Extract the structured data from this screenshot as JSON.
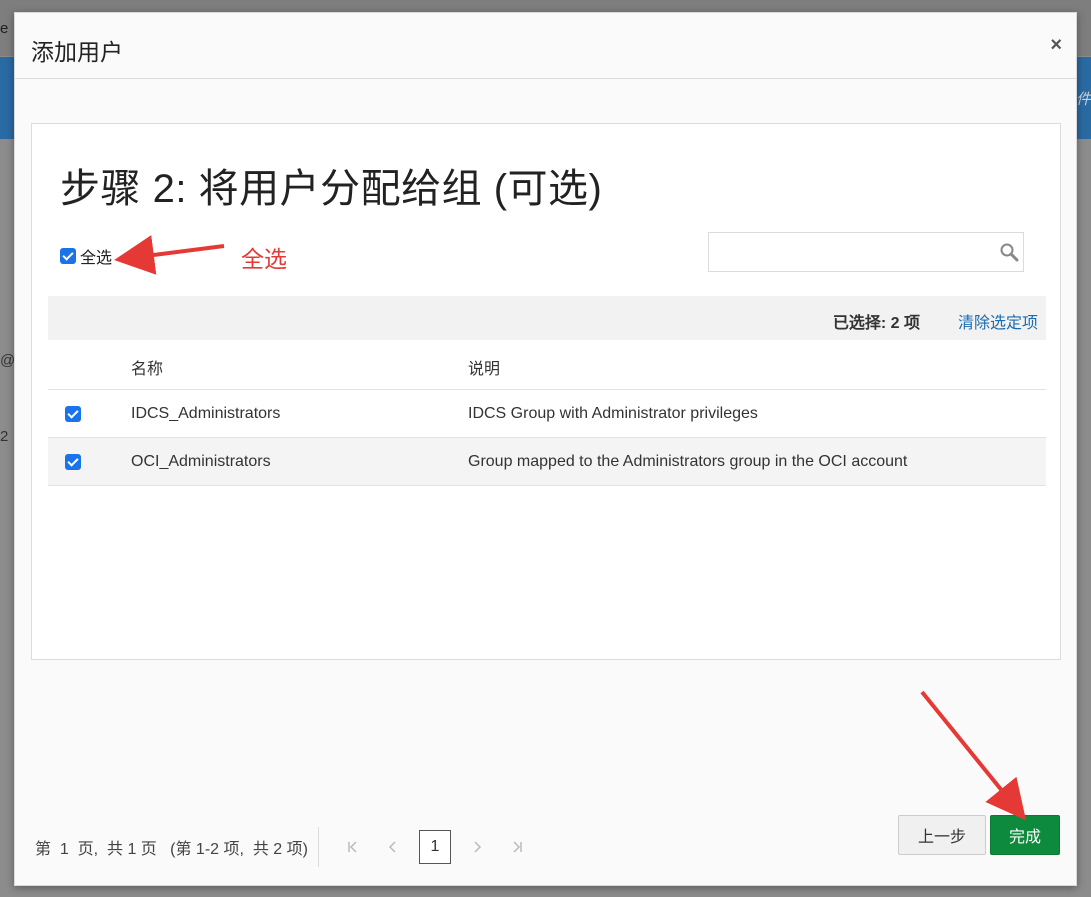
{
  "background": {
    "top_text": "e",
    "right_text": "件",
    "left_at": "@c",
    "left_mark": "2"
  },
  "modal": {
    "title": "添加用户",
    "close_label": "×",
    "step_title": "步骤 2: 将用户分配给组 (可选)",
    "select_all_label": "全选",
    "search": {
      "value": "",
      "placeholder": ""
    },
    "summary": {
      "selected_text": "已选择: 2 项",
      "clear_label": "清除选定项"
    },
    "table": {
      "headers": {
        "name": "名称",
        "description": "说明"
      },
      "rows": [
        {
          "checked": true,
          "name": "IDCS_Administrators",
          "description": "IDCS Group with Administrator privileges"
        },
        {
          "checked": true,
          "name": "OCI_Administrators",
          "description": "Group mapped to the Administrators group in the OCI account"
        }
      ]
    },
    "pager": {
      "text": "第  1  页,  共 1 页   (第 1-2 项,  共 2 项)",
      "current_page": "1",
      "first_icon": "first-page-icon",
      "prev_icon": "prev-page-icon",
      "next_icon": "next-page-icon",
      "last_icon": "last-page-icon"
    },
    "buttons": {
      "prev_label": "上一步",
      "done_label": "完成"
    }
  },
  "annotations": {
    "select_all_label": "全选",
    "color": "#e53935"
  },
  "colors": {
    "primary_checkbox": "#1a73e8",
    "done_button": "#0e8a3c",
    "link": "#1a6bb0"
  }
}
